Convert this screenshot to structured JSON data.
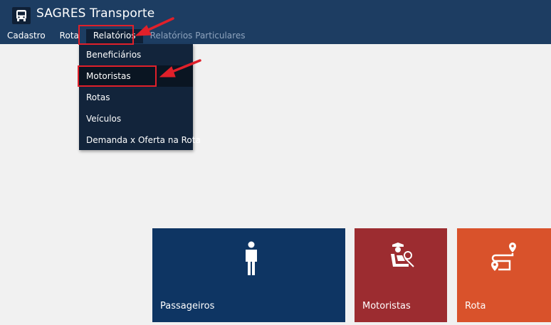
{
  "app": {
    "title": "SAGRES Transporte",
    "icon": "bus-icon"
  },
  "menu": {
    "items": [
      {
        "label": "Cadastro"
      },
      {
        "label": "Rota"
      },
      {
        "label": "Relatórios"
      },
      {
        "label": "Relatórios Particulares"
      }
    ]
  },
  "dropdown": {
    "items": [
      {
        "label": "Beneficiários"
      },
      {
        "label": "Motoristas"
      },
      {
        "label": "Rotas"
      },
      {
        "label": "Veículos"
      },
      {
        "label": "Demanda x Oferta na Rota"
      }
    ]
  },
  "tiles": [
    {
      "label": "Passageiros",
      "icon": "person-icon",
      "color": "#0e3563"
    },
    {
      "label": "Motoristas",
      "icon": "driver-icon",
      "color": "#9c2c30"
    },
    {
      "label": "Rota",
      "icon": "route-icon",
      "color": "#d9522b"
    }
  ],
  "colors": {
    "header": "#1d3d62",
    "dropdown": "#12243b",
    "annotation": "#e0202a",
    "background": "#f1f1f1"
  }
}
